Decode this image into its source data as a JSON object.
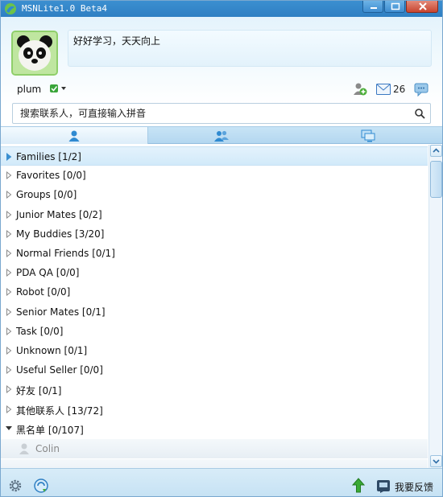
{
  "window": {
    "title": "MSNLite1.0 Beta4"
  },
  "profile": {
    "status_message": "好好学习，天天向上",
    "username": "plum",
    "mail_count": "26"
  },
  "search": {
    "placeholder": "搜索联系人，可直接输入拼音"
  },
  "groups": [
    {
      "label": "Families [1/2]",
      "expanded": false,
      "selected": true
    },
    {
      "label": "Favorites [0/0]",
      "expanded": false
    },
    {
      "label": "Groups [0/0]",
      "expanded": false
    },
    {
      "label": "Junior Mates [0/2]",
      "expanded": false
    },
    {
      "label": "My Buddies [3/20]",
      "expanded": false
    },
    {
      "label": "Normal Friends [0/1]",
      "expanded": false
    },
    {
      "label": "PDA QA [0/0]",
      "expanded": false
    },
    {
      "label": "Robot [0/0]",
      "expanded": false
    },
    {
      "label": "Senior Mates [0/1]",
      "expanded": false
    },
    {
      "label": "Task [0/0]",
      "expanded": false
    },
    {
      "label": "Unknown [0/1]",
      "expanded": false
    },
    {
      "label": "Useful Seller [0/0]",
      "expanded": false
    },
    {
      "label": "好友 [0/1]",
      "expanded": false
    },
    {
      "label": "其他联系人 [13/72]",
      "expanded": false
    },
    {
      "label": "黑名单 [0/107]",
      "expanded": true
    }
  ],
  "contacts": [
    {
      "name": "Colin"
    }
  ],
  "footer": {
    "feedback_label": "我要反馈"
  },
  "colors": {
    "titlebar": "#2f7fc3",
    "accent": "#3b8fd0",
    "status_online": "#3aa53a"
  },
  "icons": [
    "app-logo-icon",
    "minimize-icon",
    "maximize-icon",
    "close-icon",
    "add-contact-icon",
    "mail-icon",
    "chat-icon",
    "search-icon",
    "contacts-tab-icon",
    "groups-tab-icon",
    "devices-tab-icon",
    "settings-icon",
    "update-icon",
    "upload-icon",
    "feedback-icon"
  ]
}
